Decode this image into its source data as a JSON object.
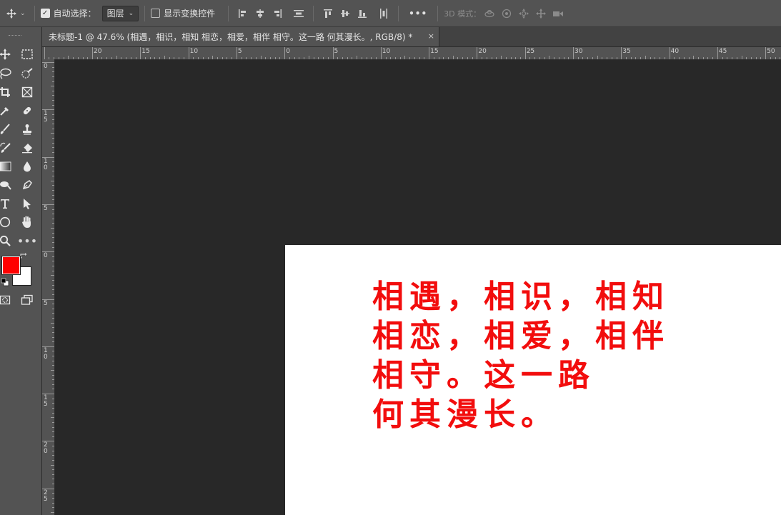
{
  "options_bar": {
    "auto_select_label": "自动选择：",
    "auto_select_checked": true,
    "layer_select_value": "图层",
    "show_transform_label": "显示变换控件",
    "show_transform_checked": false,
    "more_label": "•••",
    "mode3d_label": "3D 模式："
  },
  "document_tab": {
    "title": "未标题-1 @ 47.6% (相遇，相识，相知 相恋，相爱，相伴 相守。这一路 何其漫长。, RGB/8) *",
    "close_label": "×"
  },
  "ruler_h_labels": [
    "20",
    "15",
    "10",
    "5",
    "0",
    "5",
    "10",
    "15",
    "20",
    "25",
    "30",
    "35",
    "40",
    "45",
    "50"
  ],
  "ruler_v_labels": [
    "0",
    "1\n5",
    "1\n0",
    "5",
    "0",
    "5",
    "1\n0",
    "1\n5",
    "2\n0",
    "2\n5"
  ],
  "canvas": {
    "text_lines": [
      "相遇，相识，相知",
      "相恋，相爱，相伴",
      "相守。这一路",
      "何其漫长。"
    ],
    "text_color": "#f20d0d",
    "background_color": "#ffffff"
  },
  "colors": {
    "foreground": "#ff0000",
    "background": "#ffffff",
    "panel": "#535353",
    "pasteboard": "#282828"
  },
  "toolbar": {
    "more_label": "•••",
    "tools": [
      "move-tool",
      "marquee-tool",
      "lasso-tool",
      "quick-select-tool",
      "crop-tool",
      "frame-tool",
      "eyedropper-tool",
      "healing-tool",
      "brush-tool",
      "stamp-tool",
      "history-brush-tool",
      "eraser-tool",
      "gradient-tool",
      "blur-tool",
      "dodge-tool",
      "pen-tool",
      "type-tool",
      "path-select-tool",
      "ellipse-tool",
      "hand-tool",
      "zoom-tool",
      "more-tools",
      "quick-mask",
      "screen-mode"
    ]
  }
}
